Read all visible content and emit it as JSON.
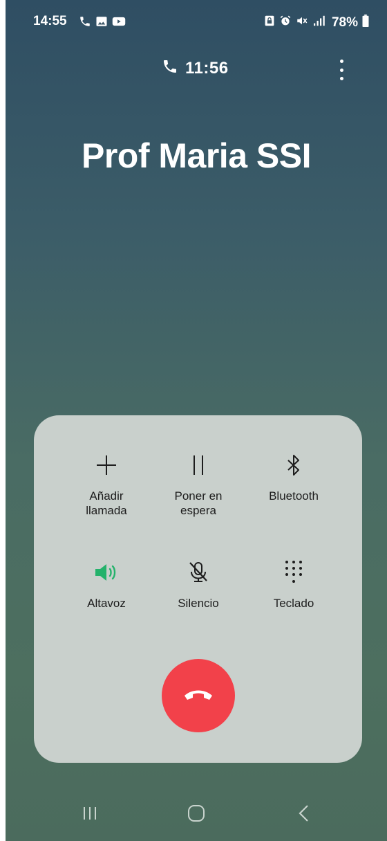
{
  "status_bar": {
    "time": "14:55",
    "battery": "78%",
    "left_icons": [
      "phone-icon",
      "image-icon",
      "youtube-icon"
    ],
    "right_icons": [
      "lock-icon",
      "alarm-icon",
      "mute-icon",
      "signal-icon",
      "battery-icon"
    ]
  },
  "call": {
    "duration": "11:56",
    "contact_name": "Prof Maria SSI"
  },
  "controls": [
    {
      "label": "Añadir\nllamada",
      "icon": "plus-icon",
      "active": false
    },
    {
      "label": "Poner en\nespera",
      "icon": "pause-icon",
      "active": false
    },
    {
      "label": "Bluetooth",
      "icon": "bluetooth-icon",
      "active": false
    },
    {
      "label": "Altavoz",
      "icon": "speaker-icon",
      "active": true
    },
    {
      "label": "Silencio",
      "icon": "mic-off-icon",
      "active": false
    },
    {
      "label": "Teclado",
      "icon": "keypad-icon",
      "active": false
    }
  ],
  "end_call": {
    "icon": "end-call-icon"
  },
  "nav_bar": {
    "buttons": [
      "recents-icon",
      "home-icon",
      "back-icon"
    ]
  },
  "colors": {
    "accent_active": "#24b26b",
    "end_call": "#f2414a",
    "panel": "#c9d0cc",
    "background_top": "#2f4e63",
    "background_bottom": "#4b6b5d"
  }
}
